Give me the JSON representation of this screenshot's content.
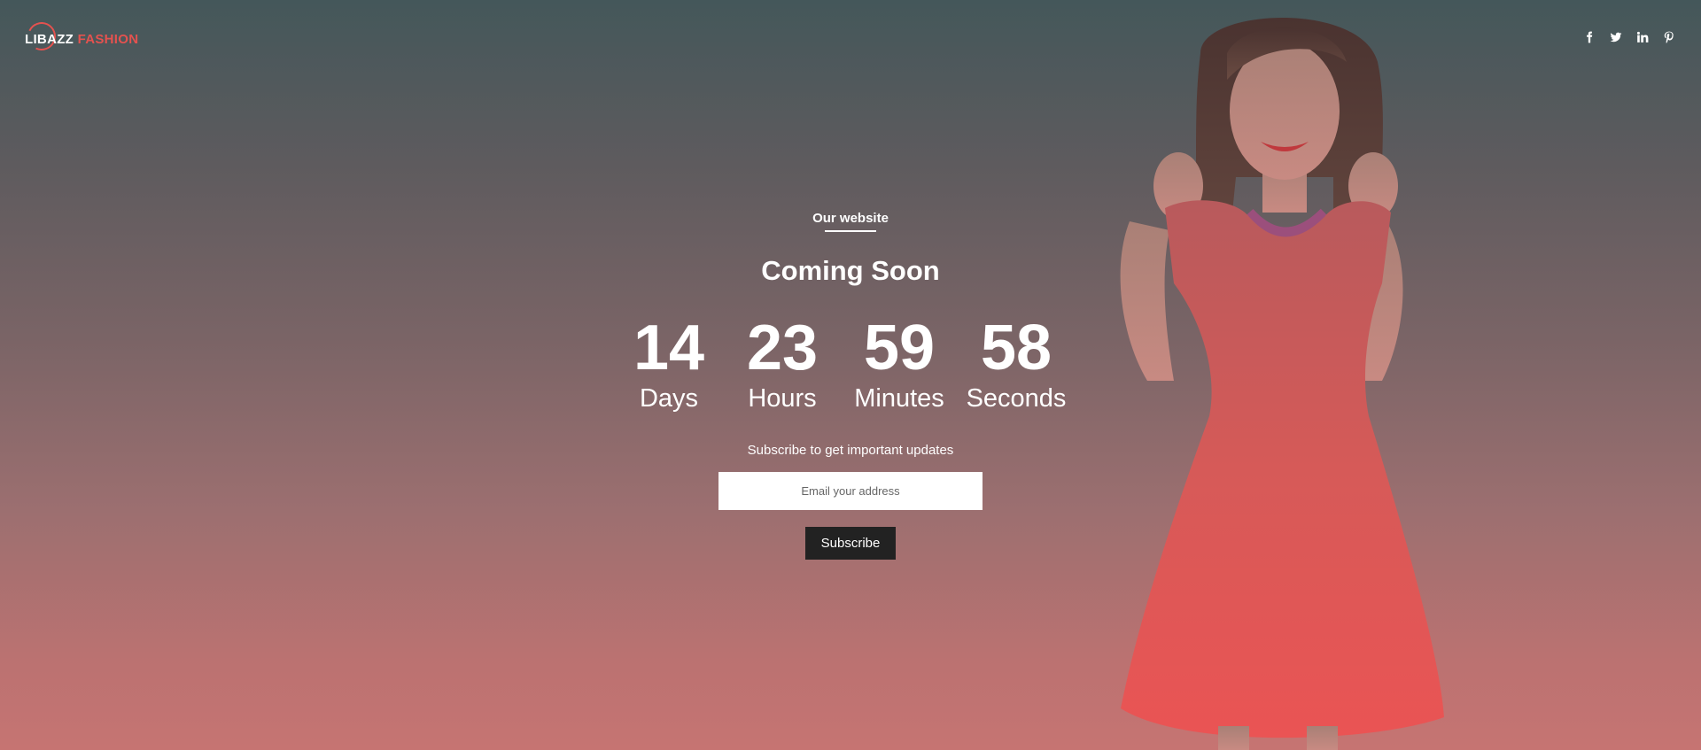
{
  "brand": {
    "name_part1": "LIBAZZ",
    "name_part2": "FASHION",
    "accent_color": "#e4524f"
  },
  "social": [
    {
      "icon": "facebook-icon"
    },
    {
      "icon": "twitter-icon"
    },
    {
      "icon": "linkedin-icon"
    },
    {
      "icon": "pinterest-icon"
    }
  ],
  "hero": {
    "eyebrow": "Our website",
    "title": "Coming Soon"
  },
  "countdown": {
    "days": {
      "value": "14",
      "label": "Days"
    },
    "hours": {
      "value": "23",
      "label": "Hours"
    },
    "minutes": {
      "value": "59",
      "label": "Minutes"
    },
    "seconds": {
      "value": "58",
      "label": "Seconds"
    }
  },
  "subscribe": {
    "note": "Subscribe to get important updates",
    "email_placeholder": "Email your address",
    "button_label": "Subscribe",
    "button_color": "#222222"
  }
}
